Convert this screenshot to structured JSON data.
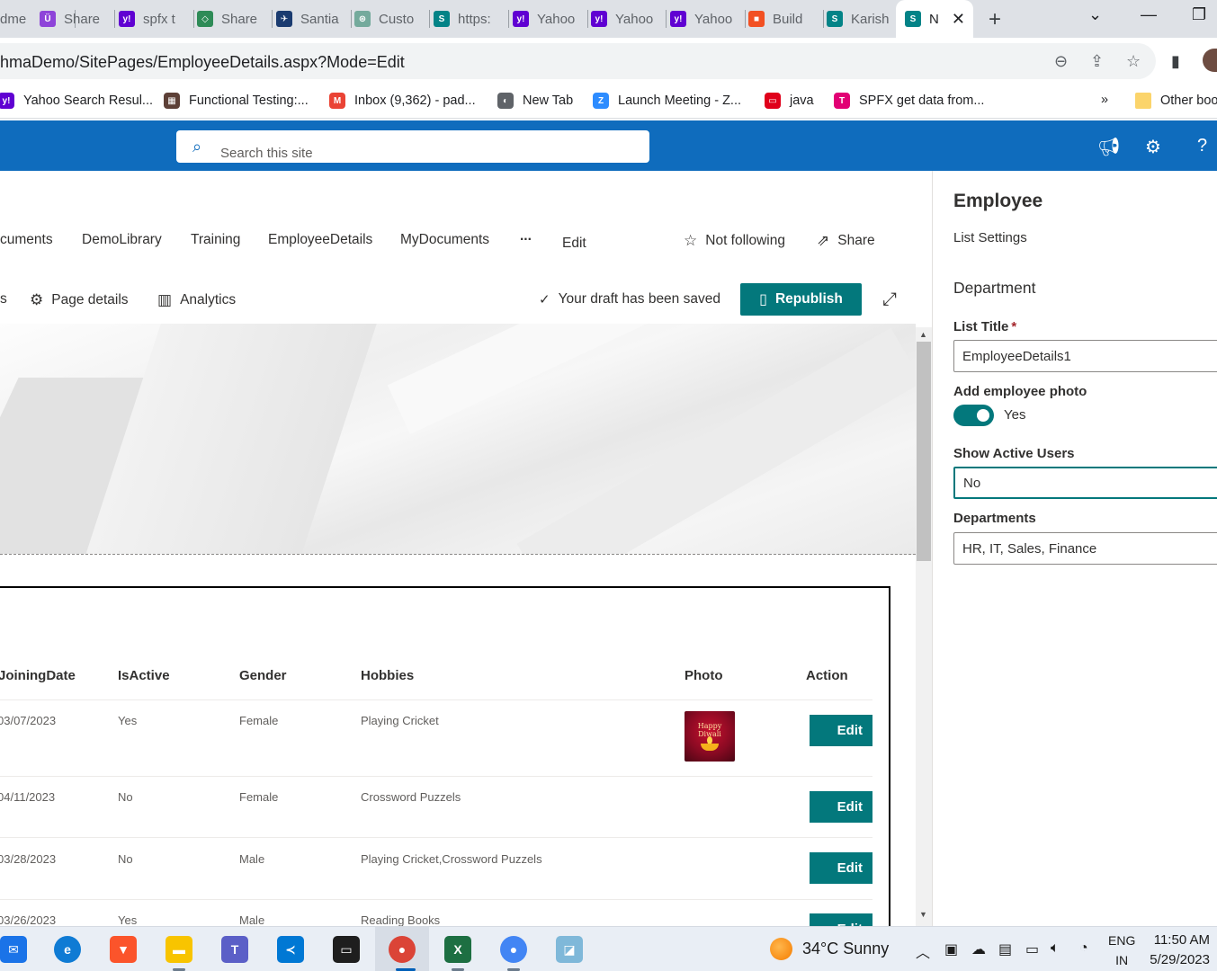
{
  "browser": {
    "tabs": [
      {
        "label": "dme",
        "color": "#5f6368",
        "glyph": ""
      },
      {
        "label": "Share",
        "color": "#8e44d9",
        "glyph": "Ü"
      },
      {
        "label": "spfx t",
        "color": "#6001d2",
        "glyph": "y!"
      },
      {
        "label": "Share",
        "color": "#2e8b57",
        "glyph": "◇"
      },
      {
        "label": "Santia",
        "color": "#1a3b70",
        "glyph": "✈"
      },
      {
        "label": "Custo",
        "color": "#74aa9c",
        "glyph": "⊛"
      },
      {
        "label": "https:",
        "color": "#038387",
        "glyph": "S"
      },
      {
        "label": "Yahoo",
        "color": "#6001d2",
        "glyph": "y!"
      },
      {
        "label": "Yahoo",
        "color": "#6001d2",
        "glyph": "y!"
      },
      {
        "label": "Yahoo",
        "color": "#6001d2",
        "glyph": "y!"
      },
      {
        "label": "Build",
        "color": "#f25022",
        "glyph": "■"
      },
      {
        "label": "Karish",
        "color": "#038387",
        "glyph": "S"
      }
    ],
    "active_tab": {
      "label": "N",
      "glyph": "S"
    },
    "url": "hmaDemo/SitePages/EmployeeDetails.aspx?Mode=Edit",
    "bookmarks": [
      {
        "label": "Yahoo Search Resul...",
        "color": "#6001d2",
        "glyph": "y!"
      },
      {
        "label": "Functional Testing:...",
        "color": "#5d4037",
        "glyph": "▦"
      },
      {
        "label": "Inbox (9,362) - pad...",
        "color": "#ea4335",
        "glyph": "M"
      },
      {
        "label": "New Tab",
        "color": "#5f6368",
        "glyph": "◐"
      },
      {
        "label": "Launch Meeting - Z...",
        "color": "#2d8cff",
        "glyph": "Z"
      },
      {
        "label": "java",
        "color": "#e0001b",
        "glyph": "▭"
      },
      {
        "label": "SPFX get data from...",
        "color": "#e20074",
        "glyph": "T"
      }
    ],
    "overflow": "»",
    "other_bookmarks": "Other boo"
  },
  "suite": {
    "search_placeholder": "Search this site"
  },
  "nav": {
    "items": [
      "cuments",
      "DemoLibrary",
      "Training",
      "EmployeeDetails",
      "MyDocuments",
      "...",
      "Edit"
    ],
    "follow": "Not following",
    "share": "Share"
  },
  "command_bar": {
    "left_fragment": "s",
    "page_details": "Page details",
    "analytics": "Analytics",
    "draft_status": "Your draft has been saved",
    "republish": "Republish"
  },
  "table": {
    "columns": [
      "JoiningDate",
      "IsActive",
      "Gender",
      "Hobbies",
      "Photo",
      "Action"
    ],
    "rows": [
      {
        "date": "03/07/2023",
        "active": "Yes",
        "gender": "Female",
        "hobbies": "Playing Cricket",
        "has_photo": true,
        "action": "Edit"
      },
      {
        "date": "04/11/2023",
        "active": "No",
        "gender": "Female",
        "hobbies": "Crossword Puzzels",
        "has_photo": false,
        "action": "Edit"
      },
      {
        "date": "03/28/2023",
        "active": "No",
        "gender": "Male",
        "hobbies": "Playing Cricket,Crossword Puzzels",
        "has_photo": false,
        "action": "Edit"
      },
      {
        "date": "03/26/2023",
        "active": "Yes",
        "gender": "Male",
        "hobbies": "Reading Books",
        "has_photo": false,
        "action": "Edit"
      }
    ],
    "photo_caption": "Happy Diwali"
  },
  "property_pane": {
    "title": "Employee",
    "subtitle": "List Settings",
    "group": "Department",
    "list_title_label": "List Title",
    "required_mark": "*",
    "list_title_value": "EmployeeDetails1",
    "photo_label": "Add employee photo",
    "photo_toggle": "Yes",
    "active_users_label": "Show Active Users",
    "active_users_value": "No",
    "departments_label": "Departments",
    "departments_value": "HR, IT, Sales, Finance"
  },
  "taskbar": {
    "temperature": "34°C",
    "condition": "Sunny",
    "lang_top": "ENG",
    "lang_bottom": "IN",
    "time": "11:50 AM",
    "date": "5/29/2023"
  },
  "colors": {
    "suite_blue": "#0f6cbd",
    "theme_teal": "#03787c"
  }
}
